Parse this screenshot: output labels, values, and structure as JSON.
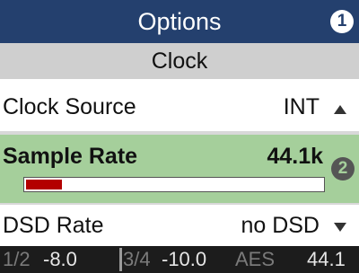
{
  "header": {
    "title": "Options",
    "badge": "1"
  },
  "section": {
    "title": "Clock"
  },
  "rows": {
    "clock_source": {
      "label": "Clock Source",
      "value": "INT",
      "nav_icon": "arrow-up-icon"
    },
    "sample_rate": {
      "label": "Sample Rate",
      "value": "44.1k",
      "badge": "2",
      "level_fraction": 0.12
    },
    "dsd_rate": {
      "label": "DSD Rate",
      "value": "no DSD",
      "nav_icon": "arrow-down-icon"
    }
  },
  "meters": {
    "ch12_label": "1/2",
    "ch12_level": "-8.0",
    "ch34_label": "3/4",
    "ch34_level": "-10.0",
    "aes_label": "AES",
    "aes_rate": "44.1"
  },
  "colors": {
    "header_bg": "#24406e",
    "subtitle_bg": "#cfcfcf",
    "selected_row_bg": "#a5cf9b",
    "level_fill": "#b30000",
    "meter_bg": "#1c1c1c"
  }
}
